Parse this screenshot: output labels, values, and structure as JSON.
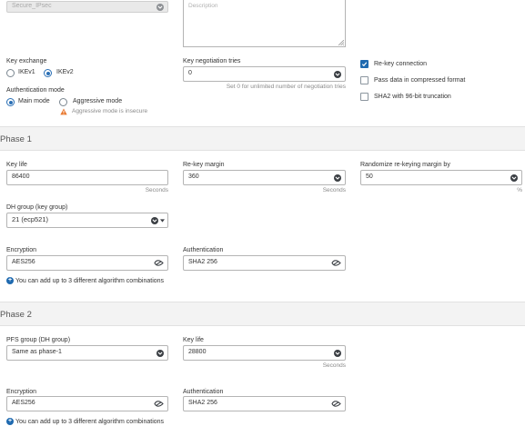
{
  "top": {
    "profile_value": "Secure_IPsec",
    "description_placeholder": "Description"
  },
  "general": {
    "key_exchange_label": "Key exchange",
    "ikev1_label": "IKEv1",
    "ikev2_label": "IKEv2",
    "key_exchange_selected": "IKEv2",
    "negotiation_tries_label": "Key negotiation tries",
    "negotiation_tries_value": "0",
    "negotiation_tries_hint": "Set 0 for unlimited number of negotiation tries",
    "auth_mode_label": "Authentication mode",
    "main_mode_label": "Main mode",
    "aggressive_mode_label": "Aggressive mode",
    "auth_mode_selected": "Main mode",
    "aggressive_warning": "Aggressive mode is insecure",
    "rekey_label": "Re-key connection",
    "rekey_checked": true,
    "compressed_label": "Pass data in compressed format",
    "compressed_checked": false,
    "sha2_label": "SHA2 with 96-bit truncation",
    "sha2_checked": false
  },
  "phase1": {
    "title": "Phase 1",
    "key_life_label": "Key life",
    "key_life_value": "86400",
    "key_life_unit": "Seconds",
    "rekey_margin_label": "Re-key margin",
    "rekey_margin_value": "360",
    "rekey_margin_unit": "Seconds",
    "randomize_label": "Randomize re-keying margin by",
    "randomize_value": "50",
    "randomize_unit": "%",
    "dh_group_label": "DH group (key group)",
    "dh_group_value": "21 (ecp521)",
    "encryption_label": "Encryption",
    "encryption_value": "AES256",
    "authentication_label": "Authentication",
    "authentication_value": "SHA2 256",
    "add_combinations": "You can add up to 3 different algorithm combinations"
  },
  "phase2": {
    "title": "Phase 2",
    "pfs_label": "PFS group (DH group)",
    "pfs_value": "Same as phase-1",
    "key_life_label": "Key life",
    "key_life_value": "28800",
    "key_life_unit": "Seconds",
    "encryption_label": "Encryption",
    "encryption_value": "AES256",
    "authentication_label": "Authentication",
    "authentication_value": "SHA2 256",
    "add_combinations": "You can add up to 3 different algorithm combinations"
  },
  "colors": {
    "accent": "#1f6ab0",
    "warning": "#e8772e",
    "section_bg": "#f3f3f3"
  },
  "icons": [
    "chevron-circle-icon",
    "remove-circle-icon",
    "chevron-down-icon",
    "warning-icon",
    "plus-circle-icon",
    "resize-grip-icon"
  ]
}
